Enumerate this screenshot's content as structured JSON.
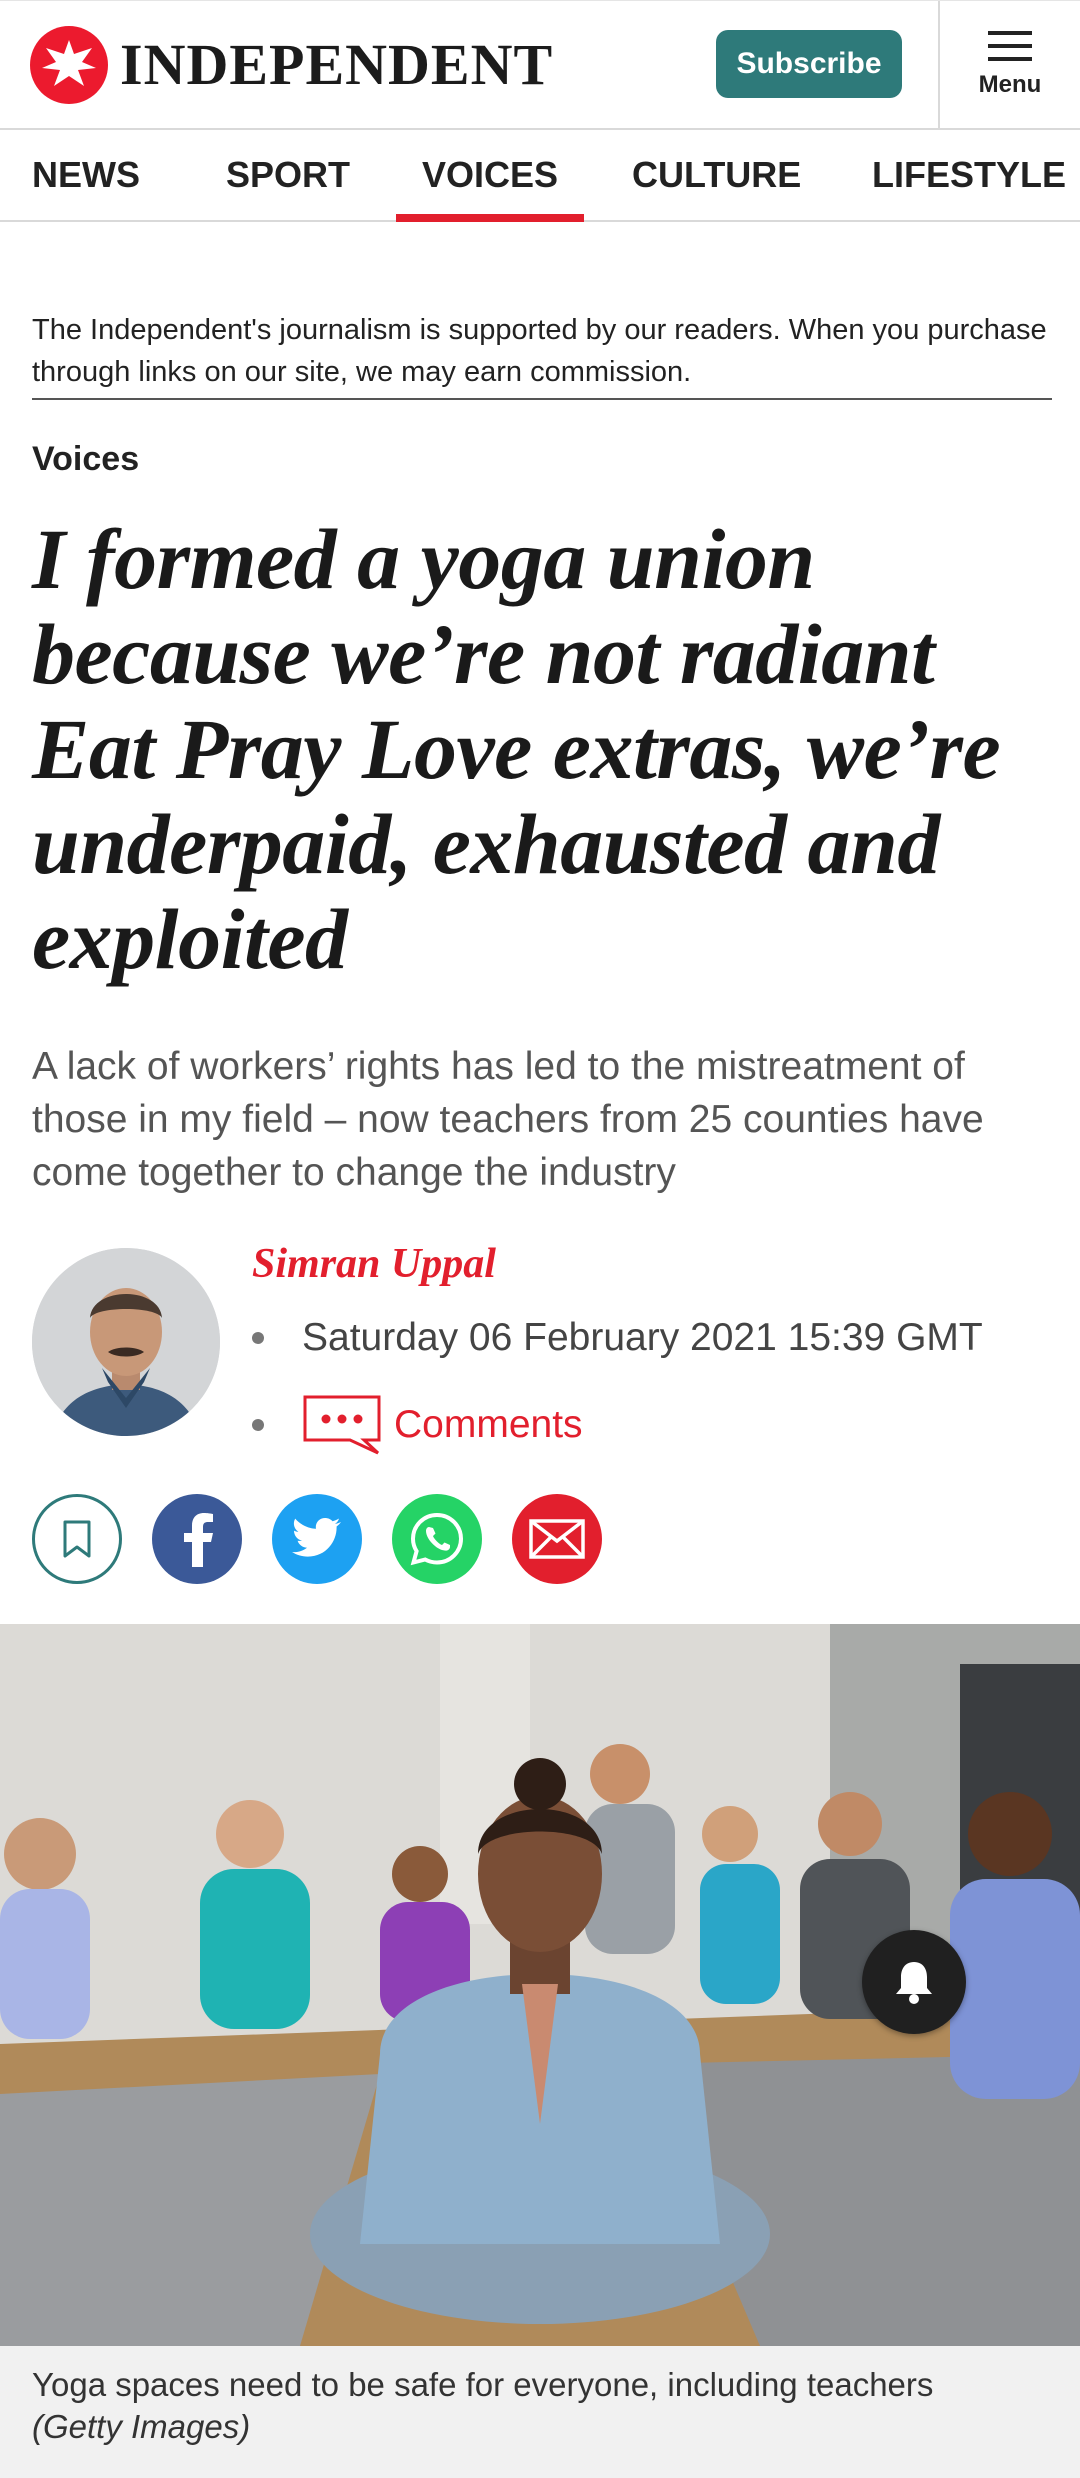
{
  "header": {
    "logo_text": "INDEPENDENT",
    "subscribe_label": "Subscribe",
    "menu_label": "Menu"
  },
  "nav": {
    "items": [
      {
        "label": "NEWS"
      },
      {
        "label": "SPORT"
      },
      {
        "label": "VOICES",
        "active": true
      },
      {
        "label": "CULTURE"
      },
      {
        "label": "LIFESTYLE"
      }
    ]
  },
  "disclosure": "The Independent's journalism is supported by our readers. When you purchase through links on our site, we may earn commission.",
  "article": {
    "section": "Voices",
    "headline": "I formed a yoga union because we’re not radiant Eat Pray Love extras, we’re underpaid, exhausted and exploited",
    "standfirst": "A lack of workers’ rights has led to the mistreatment of those in my field – now teachers from 25 counties have come together to change the industry",
    "author": "Simran Uppal",
    "date": "Saturday 06 February 2021 15:39 GMT",
    "comments_label": "Comments",
    "image_caption": "Yoga spaces need to be safe for everyone, including teachers",
    "image_credit": "(Getty Images)"
  },
  "share": [
    {
      "icon": "bookmark-icon"
    },
    {
      "icon": "facebook-icon"
    },
    {
      "icon": "twitter-icon"
    },
    {
      "icon": "whatsapp-icon"
    },
    {
      "icon": "email-icon"
    }
  ],
  "colors": {
    "brand_red": "#e21f2d",
    "subscribe_teal": "#2e7a7a",
    "facebook": "#3b5998",
    "twitter": "#1da1f2",
    "whatsapp": "#25d366",
    "email": "#e21f2d"
  }
}
